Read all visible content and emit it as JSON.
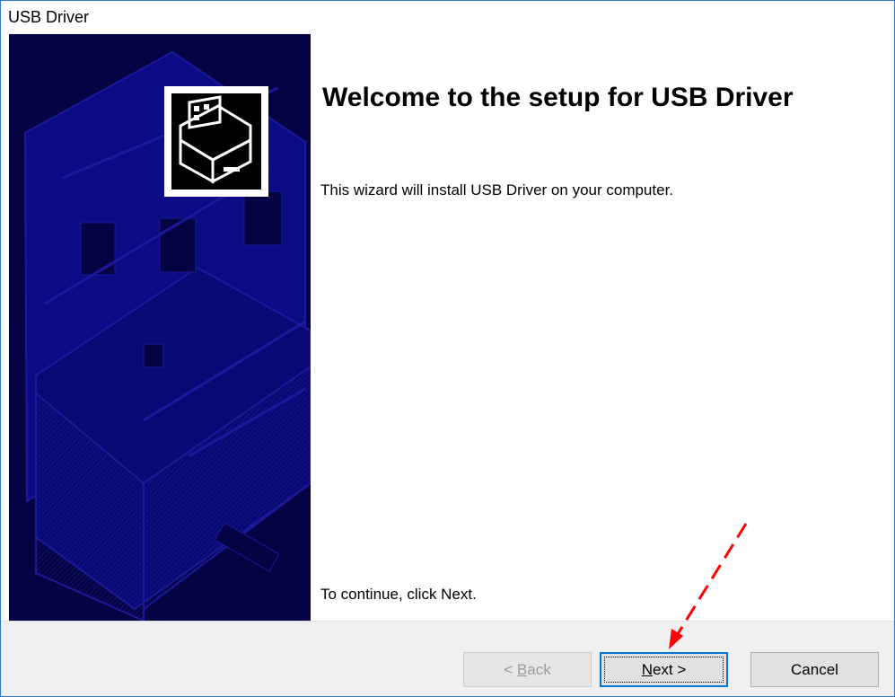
{
  "window": {
    "title": "USB Driver"
  },
  "content": {
    "heading": "Welcome to the setup for USB Driver",
    "description": "This wizard will install USB Driver on your computer.",
    "continue_text": "To continue, click Next."
  },
  "buttons": {
    "back": {
      "mnemonic": "B",
      "rest": "ack",
      "prefix": "< ",
      "state": "disabled"
    },
    "next": {
      "mnemonic": "N",
      "rest": "ext >",
      "state": "focused"
    },
    "cancel": {
      "label": "Cancel"
    }
  },
  "colors": {
    "side_panel_bg": "#040343",
    "side_panel_shape": "#0b0b86",
    "annotation_arrow": "#ff0000",
    "focus_border": "#0078d7"
  },
  "icons": {
    "setup_icon": "computer-hardware-icon"
  }
}
